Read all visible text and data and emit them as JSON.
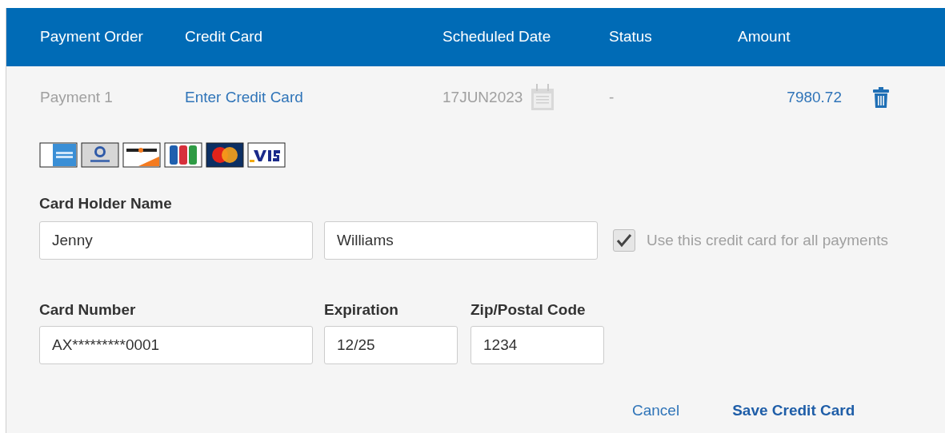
{
  "table": {
    "columns": [
      "Payment Order",
      "Credit Card",
      "Scheduled Date",
      "Status",
      "Amount"
    ],
    "rows": [
      {
        "payment_order": "Payment 1",
        "credit_card": "Enter Credit Card",
        "scheduled_date": "17JUN2023",
        "status": "-",
        "amount": "7980.72"
      }
    ]
  },
  "accepted_cards": [
    {
      "kind": "amex"
    },
    {
      "kind": "diners"
    },
    {
      "kind": "discover"
    },
    {
      "kind": "jcb"
    },
    {
      "kind": "mastercard"
    },
    {
      "kind": "visa"
    }
  ],
  "form": {
    "card_holder_label": "Card Holder Name",
    "first_name": "Jenny",
    "last_name": "Williams",
    "use_for_all": {
      "label": "Use this credit card for all payments",
      "checked": true
    },
    "card_number": {
      "label": "Card Number",
      "value": "AX*********0001"
    },
    "expiration": {
      "label": "Expiration",
      "value": "12/25"
    },
    "zip": {
      "label": "Zip/Postal Code",
      "value": "1234"
    },
    "buttons": [
      "Cancel",
      "Save Credit Card"
    ]
  }
}
